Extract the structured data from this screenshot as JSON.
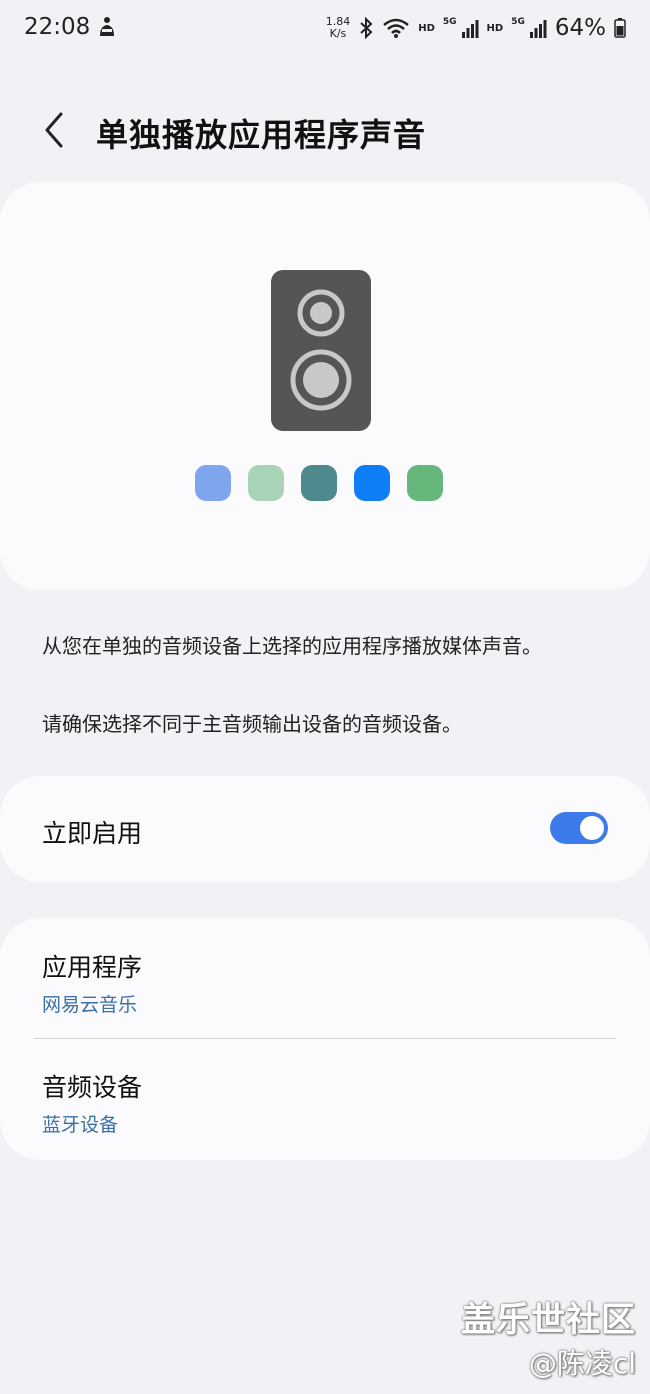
{
  "status_bar": {
    "time": "22:08",
    "net_speed_value": "1.84",
    "net_speed_unit": "K/s",
    "hd_label_1": "HD",
    "hd_label_2": "HD",
    "network_1": "5G",
    "network_2": "5G",
    "battery": "64%"
  },
  "header": {
    "title": "单独播放应用程序声音"
  },
  "hero": {
    "swatch_colors": [
      "#7fa6ec",
      "#a9d3b7",
      "#4e8a8d",
      "#0d7ef5",
      "#66b77c"
    ]
  },
  "descriptions": {
    "line1": "从您在单独的音频设备上选择的应用程序播放媒体声音。",
    "line2": "请确保选择不同于主音频输出设备的音频设备。"
  },
  "toggle": {
    "label": "立即启用",
    "state": "on"
  },
  "settings": [
    {
      "title": "应用程序",
      "value": "网易云音乐"
    },
    {
      "title": "音频设备",
      "value": "蓝牙设备"
    }
  ],
  "watermark": {
    "site": "盖乐世社区",
    "author": "@陈凌cl"
  },
  "colors": {
    "accent": "#3e7bea",
    "link": "#3a6fa8",
    "background": "#f2f2f6",
    "card": "#fbfbfd"
  }
}
